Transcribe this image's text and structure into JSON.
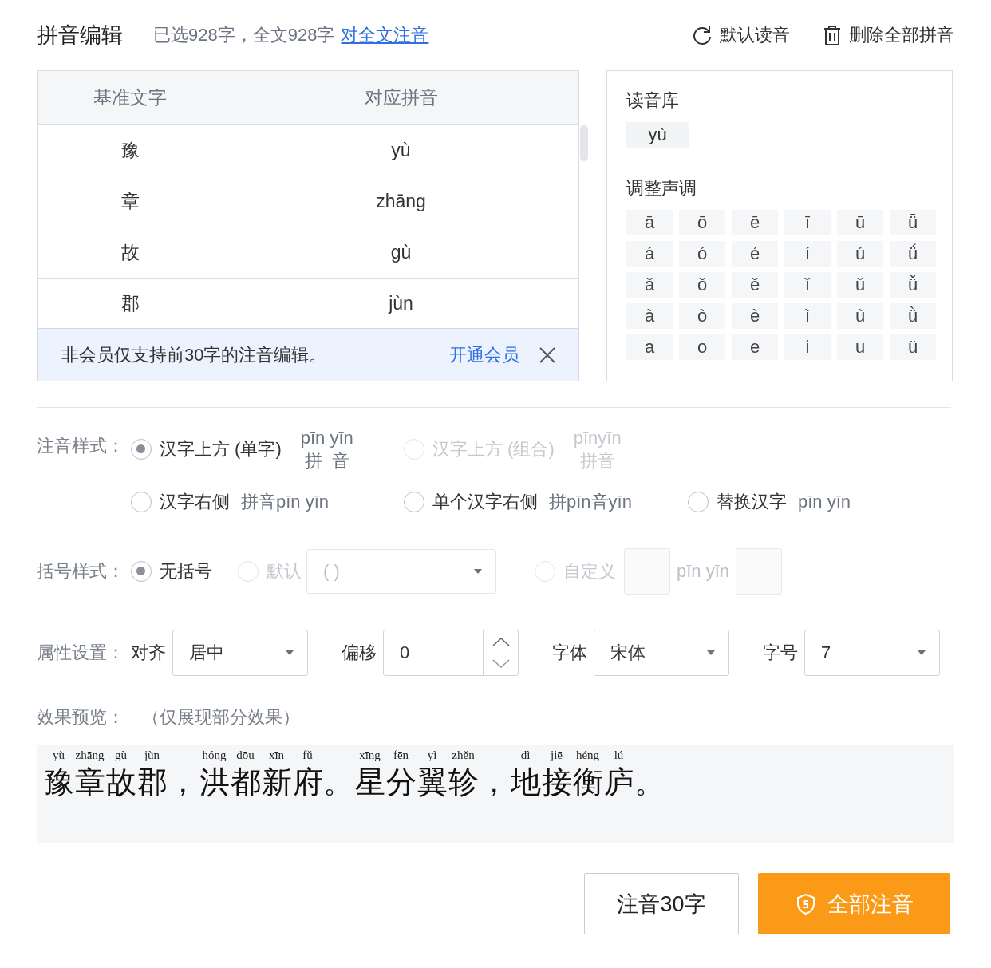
{
  "header": {
    "title": "拼音编辑",
    "summary": "已选928字，全文928字",
    "link": "对全文注音",
    "actions": [
      {
        "kind": "reset",
        "label": "默认读音"
      },
      {
        "kind": "delete",
        "label": "删除全部拼音"
      }
    ]
  },
  "table": {
    "columns": [
      "基准文字",
      "对应拼音"
    ],
    "rows": [
      {
        "hanzi": "豫",
        "pinyin": "yù"
      },
      {
        "hanzi": "章",
        "pinyin": "zhāng"
      },
      {
        "hanzi": "故",
        "pinyin": "gù"
      },
      {
        "hanzi": "郡",
        "pinyin": "jùn"
      }
    ],
    "notice": {
      "text": "非会员仅支持前30字的注音编辑。",
      "link": "开通会员"
    }
  },
  "reading_panel": {
    "library_title": "读音库",
    "readings": [
      "yù"
    ],
    "tone_title": "调整声调",
    "tones": [
      [
        "ā",
        "ō",
        "ē",
        "ī",
        "ū",
        "ǖ"
      ],
      [
        "á",
        "ó",
        "é",
        "í",
        "ú",
        "ǘ"
      ],
      [
        "ǎ",
        "ǒ",
        "ě",
        "ǐ",
        "ǔ",
        "ǚ"
      ],
      [
        "à",
        "ò",
        "è",
        "ì",
        "ù",
        "ǜ"
      ],
      [
        "a",
        "o",
        "e",
        "i",
        "u",
        "ü"
      ]
    ]
  },
  "annotation_style": {
    "label": "注音样式：",
    "options": [
      {
        "kind": "stacked",
        "label": "汉字上方 (单字)",
        "sample_top": "pīn yīn",
        "sample_bottom": "拼  音",
        "selected": true,
        "disabled": false
      },
      {
        "kind": "stacked",
        "label": "汉字上方 (组合)",
        "sample_top": "pīnyīn",
        "sample_bottom": "拼音",
        "selected": false,
        "disabled": true
      },
      {
        "kind": "inline",
        "label": "汉字右侧",
        "sample": "拼音pīn yīn",
        "selected": false,
        "disabled": false
      },
      {
        "kind": "inline",
        "label": "单个汉字右侧",
        "sample": "拼pīn音yīn",
        "selected": false,
        "disabled": false
      },
      {
        "kind": "inline",
        "label": "替换汉字",
        "sample": "pīn yīn",
        "selected": false,
        "disabled": false
      }
    ]
  },
  "bracket_style": {
    "label": "括号样式：",
    "options": [
      {
        "kind": "plain",
        "label": "无括号",
        "selected": true,
        "disabled": false
      },
      {
        "kind": "dropdown",
        "label": "默认",
        "value": "( )",
        "selected": false,
        "disabled": true
      },
      {
        "kind": "custom",
        "label": "自定义",
        "sample": "pīn yīn",
        "selected": false,
        "disabled": true
      }
    ]
  },
  "properties": {
    "label": "属性设置：",
    "fields": [
      {
        "kind": "select",
        "label": "对齐",
        "value": "居中"
      },
      {
        "kind": "number",
        "label": "偏移",
        "value": "0"
      },
      {
        "kind": "select",
        "label": "字体",
        "value": "宋体"
      },
      {
        "kind": "select",
        "label": "字号",
        "value": "7"
      }
    ]
  },
  "preview": {
    "label": "效果预览：",
    "note": "（仅展现部分效果）",
    "groups": [
      {
        "chars": [
          {
            "hanzi": "豫",
            "pinyin": "yù"
          },
          {
            "hanzi": "章",
            "pinyin": "zhāng"
          },
          {
            "hanzi": "故",
            "pinyin": "gù"
          },
          {
            "hanzi": "郡",
            "pinyin": "jùn"
          }
        ],
        "punct": "，"
      },
      {
        "chars": [
          {
            "hanzi": "洪",
            "pinyin": "hóng"
          },
          {
            "hanzi": "都",
            "pinyin": "dōu"
          },
          {
            "hanzi": "新",
            "pinyin": "xīn"
          },
          {
            "hanzi": "府",
            "pinyin": "fǔ"
          }
        ],
        "punct": "。"
      },
      {
        "chars": [
          {
            "hanzi": "星",
            "pinyin": "xīng"
          },
          {
            "hanzi": "分",
            "pinyin": "fēn"
          },
          {
            "hanzi": "翼",
            "pinyin": "yì"
          },
          {
            "hanzi": "轸",
            "pinyin": "zhěn"
          }
        ],
        "punct": "，"
      },
      {
        "chars": [
          {
            "hanzi": "地",
            "pinyin": "dì"
          },
          {
            "hanzi": "接",
            "pinyin": "jiē"
          },
          {
            "hanzi": "衡",
            "pinyin": "héng"
          },
          {
            "hanzi": "庐",
            "pinyin": "lú"
          }
        ],
        "punct": "。"
      }
    ]
  },
  "buttons": [
    {
      "kind": "secondary",
      "label": "注音30字"
    },
    {
      "kind": "primary",
      "label": "全部注音"
    }
  ]
}
